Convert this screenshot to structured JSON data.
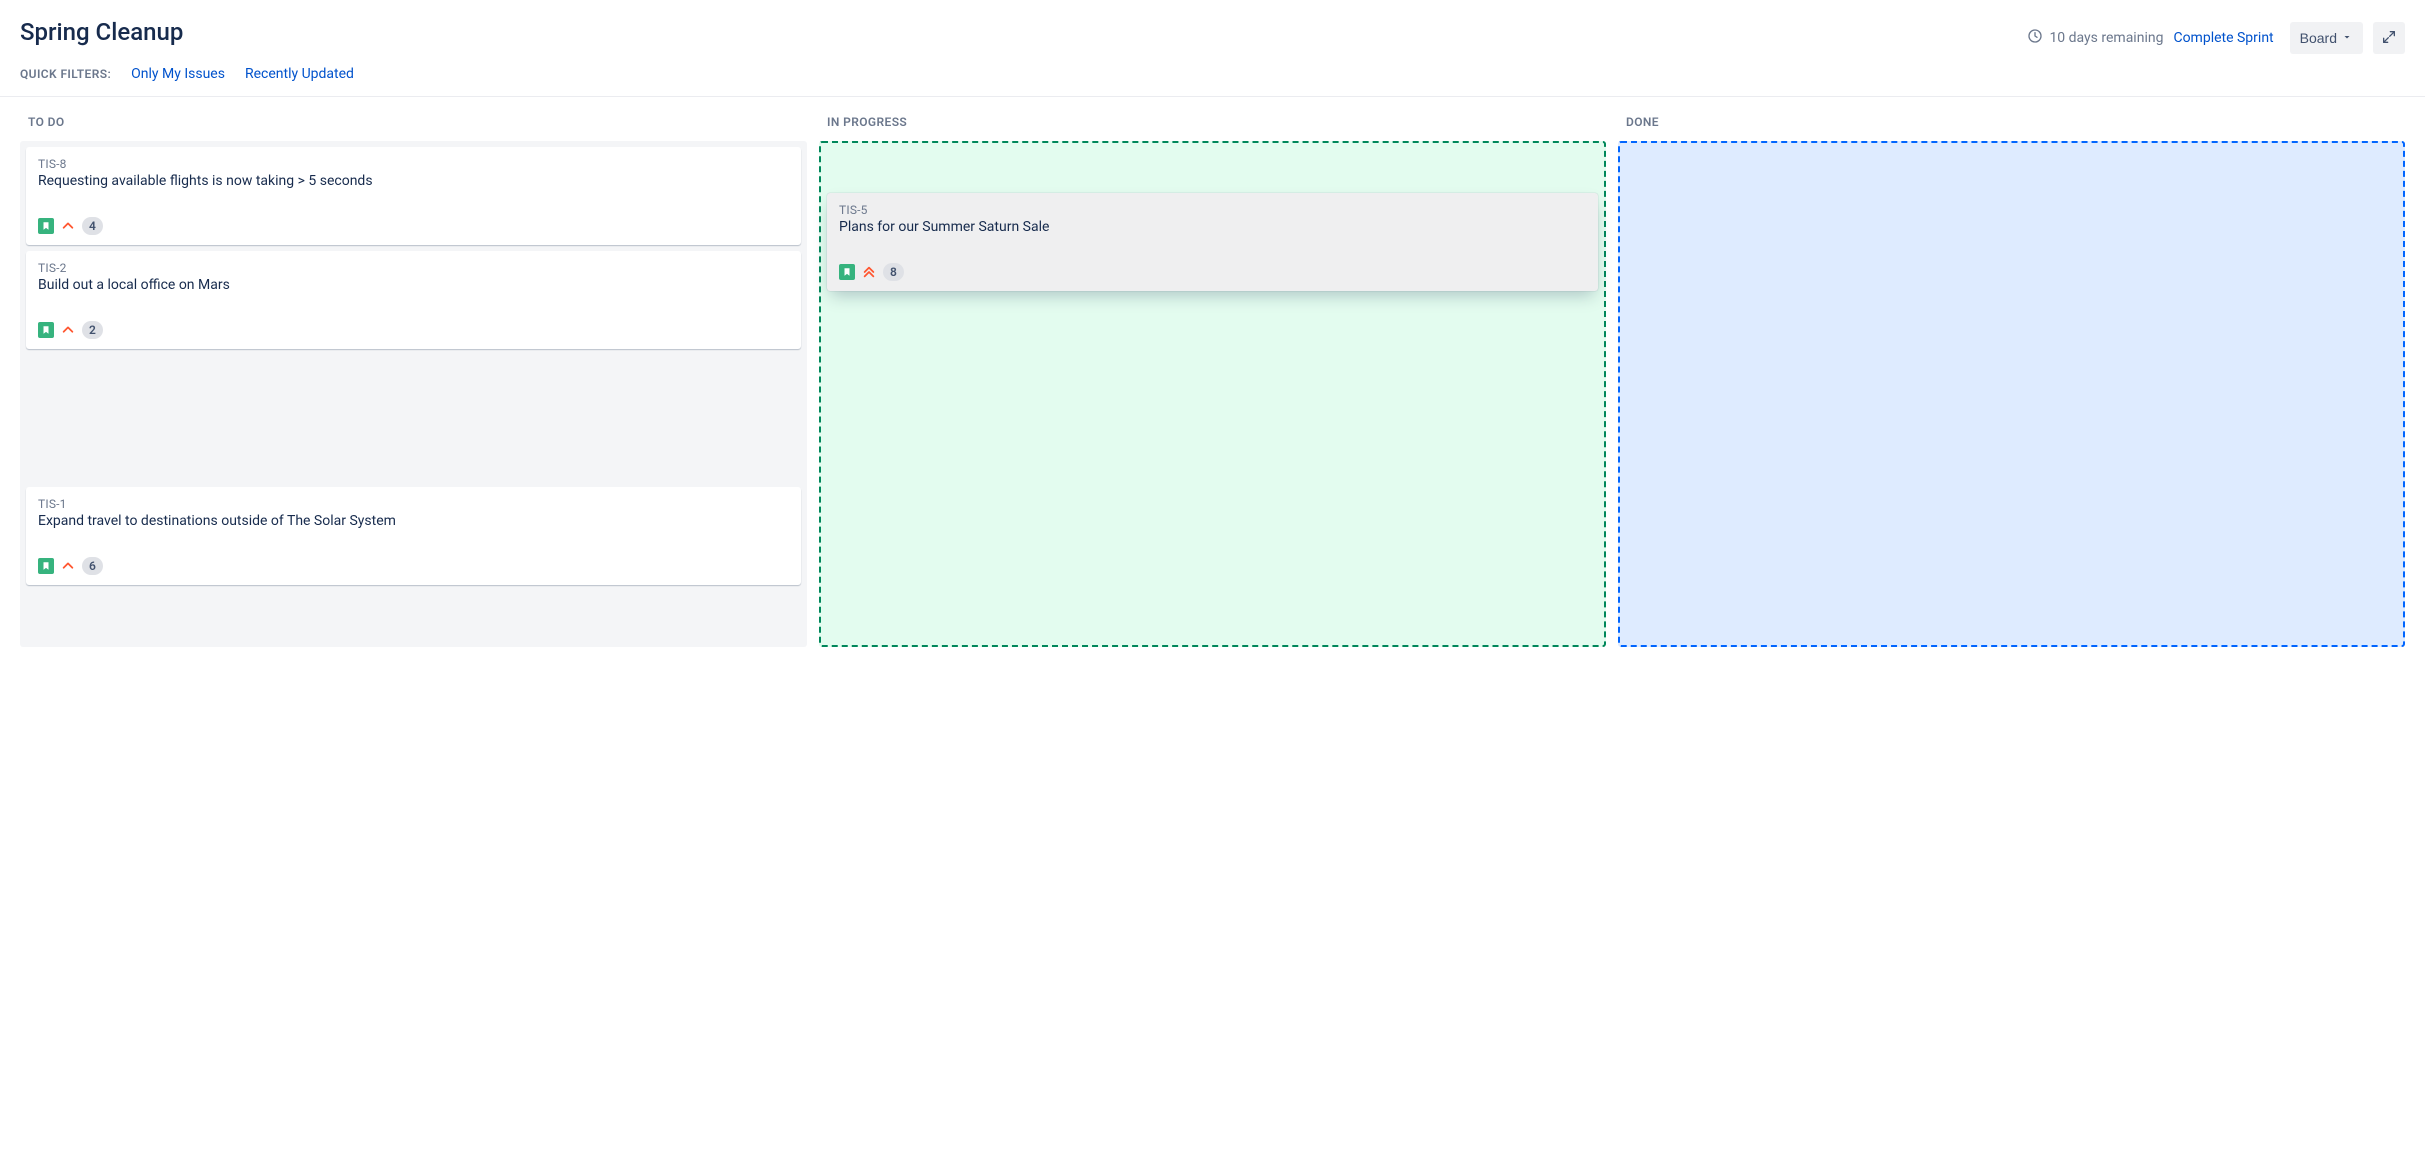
{
  "header": {
    "title": "Spring Cleanup",
    "remaining_text": "10 days remaining",
    "complete_label": "Complete Sprint",
    "board_button_label": "Board"
  },
  "filters": {
    "label": "QUICK FILTERS:",
    "only_my_issues": "Only My Issues",
    "recently_updated": "Recently Updated"
  },
  "columns": {
    "todo": "TO DO",
    "in_progress": "IN PROGRESS",
    "done": "DONE"
  },
  "cards": {
    "todo": [
      {
        "key": "TIS-8",
        "summary": "Requesting available flights is now taking > 5 seconds",
        "priority": "high",
        "story_points": "4"
      },
      {
        "key": "TIS-2",
        "summary": "Build out a local office on Mars",
        "priority": "high",
        "story_points": "2"
      },
      {
        "key": "TIS-1",
        "summary": "Expand travel to destinations outside of The Solar System",
        "priority": "high",
        "story_points": "6"
      }
    ],
    "in_progress": [
      {
        "key": "TIS-5",
        "summary": "Plans for our Summer Saturn Sale",
        "priority": "highest",
        "story_points": "8"
      }
    ],
    "done": []
  }
}
